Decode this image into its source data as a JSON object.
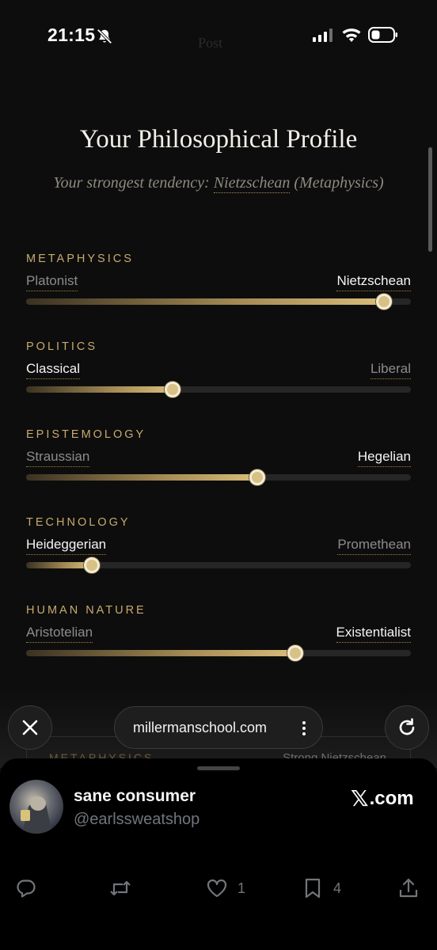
{
  "status_bar": {
    "time": "21:15"
  },
  "page": {
    "title": "Your Philosophical Profile",
    "subtitle_prefix": "Your strongest tendency: ",
    "subtitle_link": "Nietzschean",
    "subtitle_suffix": " (Metaphysics)"
  },
  "dimensions": [
    {
      "name": "METAPHYSICS",
      "left": "Platonist",
      "right": "Nietzschean",
      "active": "right",
      "value_percent": 93
    },
    {
      "name": "POLITICS",
      "left": "Classical",
      "right": "Liberal",
      "active": "left",
      "value_percent": 38
    },
    {
      "name": "EPISTEMOLOGY",
      "left": "Straussian",
      "right": "Hegelian",
      "active": "right",
      "value_percent": 60
    },
    {
      "name": "TECHNOLOGY",
      "left": "Heideggerian",
      "right": "Promethean",
      "active": "left",
      "value_percent": 17
    },
    {
      "name": "HUMAN NATURE",
      "left": "Aristotelian",
      "right": "Existentialist",
      "active": "right",
      "value_percent": 70
    }
  ],
  "hidden_card": {
    "label": "METAPHYSICS",
    "value": "Strong Nietzschean"
  },
  "browser": {
    "url": "millermanschool.com"
  },
  "tweet": {
    "name": "sane consumer",
    "handle": "@earlssweatshop",
    "source_x": "𝕏",
    "source_domain": ".com",
    "likes": "1",
    "bookmarks": "4"
  },
  "colors": {
    "accent": "#c9aa6e",
    "background": "#0d0d0d",
    "thumb": "#d8c185"
  },
  "icons": [
    "bell-slash-icon",
    "signal-icon",
    "wifi-icon",
    "battery-icon",
    "close-icon",
    "more-vertical-icon",
    "reload-icon",
    "reply-icon",
    "retweet-icon",
    "like-icon",
    "bookmark-icon",
    "share-icon"
  ]
}
